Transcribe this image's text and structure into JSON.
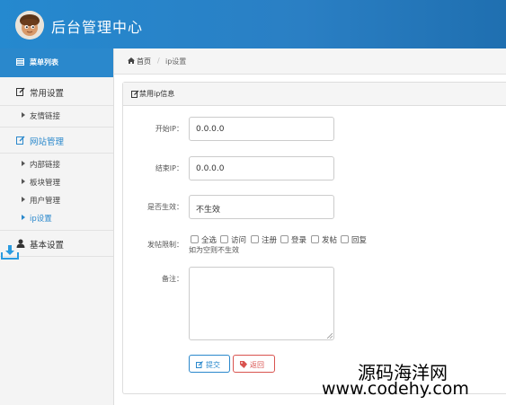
{
  "header": {
    "title": "后台管理中心"
  },
  "sidebar": {
    "head_label": "菜单列表",
    "groups": [
      {
        "label": "常用设置"
      },
      {
        "label": "网站管理"
      },
      {
        "label": "基本设置"
      }
    ],
    "group1_items": [
      {
        "label": "友情链接"
      }
    ],
    "group2_items": [
      {
        "label": "内部链接"
      },
      {
        "label": "板块管理"
      },
      {
        "label": "用户管理"
      },
      {
        "label": "ip设置"
      }
    ]
  },
  "breadcrumb": {
    "home": "首页",
    "current": "ip设置"
  },
  "panel": {
    "title": "禁用ip信息",
    "form": {
      "start_ip_label": "开始IP：",
      "start_ip_value": "0.0.0.0",
      "end_ip_label": "结束IP：",
      "end_ip_value": "0.0.0.0",
      "effective_label": "是否生效：",
      "effective_value": "不生效",
      "restrict_label": "发帖限制：",
      "restrict_options": [
        {
          "label": "全选"
        },
        {
          "label": "访问"
        },
        {
          "label": "注册"
        },
        {
          "label": "登录"
        },
        {
          "label": "发帖"
        },
        {
          "label": "回复"
        }
      ],
      "restrict_hint": "如为空则不生效",
      "note_label": "备注：",
      "note_value": ""
    },
    "submit_label": "提交",
    "back_label": "返回"
  },
  "watermark": {
    "line1": "源码海洋网",
    "line2": "www.codehy.com"
  },
  "colors": {
    "primary": "#2a88cc",
    "danger": "#d9534f"
  }
}
